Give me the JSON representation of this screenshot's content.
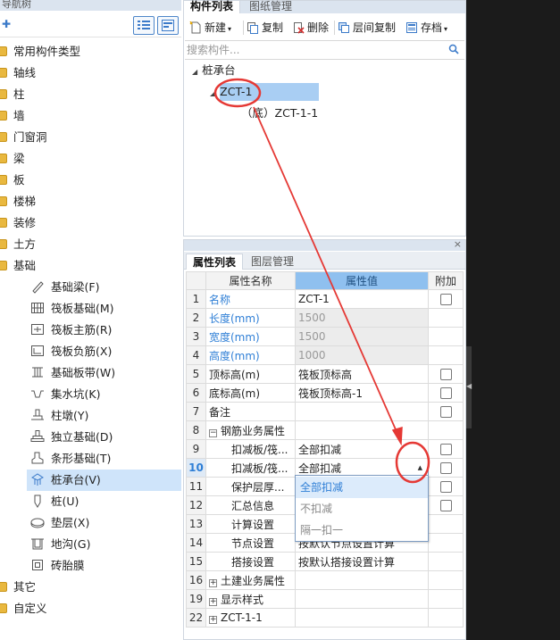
{
  "nav": {
    "title": "导航树",
    "categories": [
      {
        "label": "常用构件类型"
      },
      {
        "label": "轴线"
      },
      {
        "label": "柱"
      },
      {
        "label": "墙"
      },
      {
        "label": "门窗洞"
      },
      {
        "label": "梁"
      },
      {
        "label": "板"
      },
      {
        "label": "楼梯"
      },
      {
        "label": "装修"
      },
      {
        "label": "土方"
      },
      {
        "label": "基础"
      }
    ],
    "foundation_items": [
      {
        "label": "基础梁(F)",
        "icon": "foundation-beam-icon"
      },
      {
        "label": "筏板基础(M)",
        "icon": "raft-foundation-icon"
      },
      {
        "label": "筏板主筋(R)",
        "icon": "raft-main-rebar-icon"
      },
      {
        "label": "筏板负筋(X)",
        "icon": "raft-negative-rebar-icon"
      },
      {
        "label": "基础板带(W)",
        "icon": "foundation-strip-icon"
      },
      {
        "label": "集水坑(K)",
        "icon": "sump-pit-icon"
      },
      {
        "label": "柱墩(Y)",
        "icon": "column-pier-icon"
      },
      {
        "label": "独立基础(D)",
        "icon": "isolated-foundation-icon"
      },
      {
        "label": "条形基础(T)",
        "icon": "strip-foundation-icon"
      },
      {
        "label": "桩承台(V)",
        "icon": "pile-cap-icon"
      },
      {
        "label": "桩(U)",
        "icon": "pile-icon"
      },
      {
        "label": "垫层(X)",
        "icon": "cushion-layer-icon"
      },
      {
        "label": "地沟(G)",
        "icon": "trench-icon"
      },
      {
        "label": "砖胎膜",
        "icon": "brick-mold-icon"
      }
    ],
    "bottom_categories": [
      {
        "label": "其它"
      },
      {
        "label": "自定义"
      }
    ]
  },
  "component_panel": {
    "tabs": [
      "构件列表",
      "图纸管理"
    ],
    "toolbar": {
      "new_label": "新建",
      "copy_label": "复制",
      "delete_label": "删除",
      "floor_copy_label": "层间复制",
      "save_label": "存档"
    },
    "search_placeholder": "搜索构件...",
    "tree": {
      "root": "桩承台",
      "child": "ZCT-1",
      "grandchild": "（底）ZCT-1-1"
    }
  },
  "property_panel": {
    "tabs": [
      "属性列表",
      "图层管理"
    ],
    "columns": {
      "name": "属性名称",
      "value": "属性值",
      "extra": "附加"
    },
    "rows": [
      {
        "num": "1",
        "name": "名称",
        "value": "ZCT-1"
      },
      {
        "num": "2",
        "name": "长度(mm)",
        "value": "1500"
      },
      {
        "num": "3",
        "name": "宽度(mm)",
        "value": "1500"
      },
      {
        "num": "4",
        "name": "高度(mm)",
        "value": "1000"
      },
      {
        "num": "5",
        "name": "顶标高(m)",
        "value": "筏板顶标高"
      },
      {
        "num": "6",
        "name": "底标高(m)",
        "value": "筏板顶标高-1"
      },
      {
        "num": "7",
        "name": "备注",
        "value": ""
      },
      {
        "num": "8",
        "name": "钢筋业务属性",
        "value": ""
      },
      {
        "num": "9",
        "name": "扣减板/筏...",
        "value": "全部扣减"
      },
      {
        "num": "10",
        "name": "扣减板/筏...",
        "value": "全部扣减"
      },
      {
        "num": "11",
        "name": "保护层厚...",
        "value": ""
      },
      {
        "num": "12",
        "name": "汇总信息",
        "value": ""
      },
      {
        "num": "13",
        "name": "计算设置",
        "value": ""
      },
      {
        "num": "14",
        "name": "节点设置",
        "value": "按默认节点设置计算"
      },
      {
        "num": "15",
        "name": "搭接设置",
        "value": "按默认搭接设置计算"
      },
      {
        "num": "16",
        "name": "土建业务属性",
        "value": ""
      },
      {
        "num": "19",
        "name": "显示样式",
        "value": ""
      },
      {
        "num": "22",
        "name": "ZCT-1-1",
        "value": ""
      }
    ],
    "dropdown_options": [
      "全部扣减",
      "不扣减",
      "隔一扣一"
    ]
  },
  "colors": {
    "accent": "#2f7fd6",
    "annotation": "#e53935",
    "selection": "#a9cef3"
  }
}
